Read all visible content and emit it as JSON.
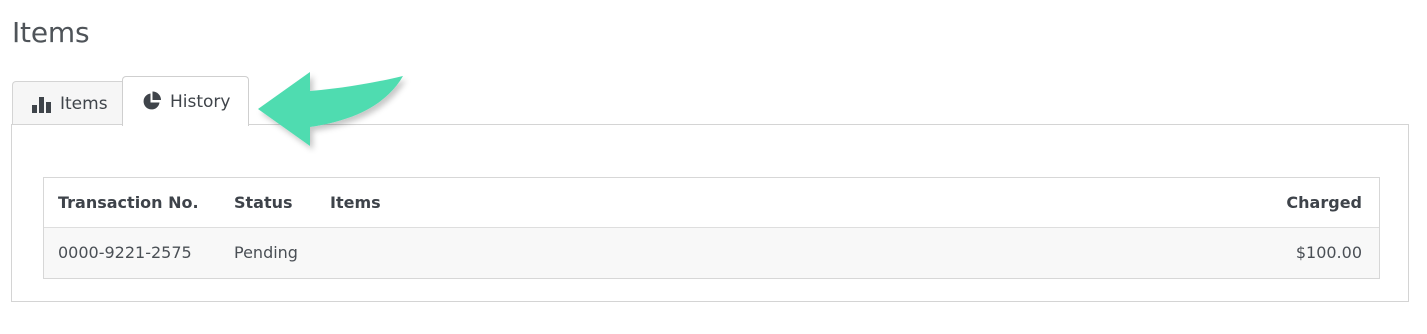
{
  "page": {
    "title": "Items"
  },
  "tabs": [
    {
      "label": "Items",
      "icon": "bar-chart-icon",
      "active": false
    },
    {
      "label": "History",
      "icon": "pie-chart-icon",
      "active": true
    }
  ],
  "table": {
    "columns": [
      "Transaction No.",
      "Status",
      "Items",
      "Charged"
    ],
    "rows": [
      {
        "transaction_no": "0000-9221-2575",
        "status": "Pending",
        "items": "",
        "charged": "$100.00"
      }
    ]
  },
  "colors": {
    "annotation_arrow": "#4fdcb0",
    "text": "#4a4f55",
    "border": "#d4d4d4"
  }
}
